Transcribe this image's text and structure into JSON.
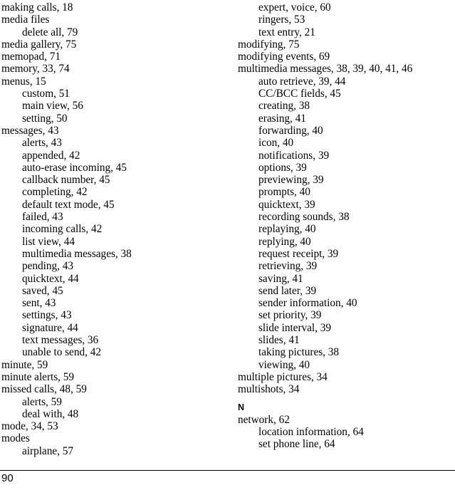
{
  "document": {
    "type": "book-index",
    "page_number": "90"
  },
  "columns": [
    {
      "name": "left-column",
      "entries": [
        {
          "text": "making calls, 18",
          "level": 0
        },
        {
          "text": "media files",
          "level": 0
        },
        {
          "text": "delete all, 79",
          "level": 1
        },
        {
          "text": "media gallery, 75",
          "level": 0
        },
        {
          "text": "memopad, 71",
          "level": 0
        },
        {
          "text": "memory, 33, 74",
          "level": 0
        },
        {
          "text": "menus, 15",
          "level": 0
        },
        {
          "text": "custom, 51",
          "level": 1
        },
        {
          "text": "main view, 56",
          "level": 1
        },
        {
          "text": "setting, 50",
          "level": 1
        },
        {
          "text": "messages, 43",
          "level": 0
        },
        {
          "text": "alerts, 43",
          "level": 1
        },
        {
          "text": "appended, 42",
          "level": 1
        },
        {
          "text": "auto-erase incoming, 45",
          "level": 1
        },
        {
          "text": "callback number, 45",
          "level": 1
        },
        {
          "text": "completing, 42",
          "level": 1
        },
        {
          "text": "default text mode, 45",
          "level": 1
        },
        {
          "text": "failed, 43",
          "level": 1
        },
        {
          "text": "incoming calls, 42",
          "level": 1
        },
        {
          "text": "list view, 44",
          "level": 1
        },
        {
          "text": "multimedia messages, 38",
          "level": 1
        },
        {
          "text": "pending, 43",
          "level": 1
        },
        {
          "text": "quicktext, 44",
          "level": 1
        },
        {
          "text": "saved, 45",
          "level": 1
        },
        {
          "text": "sent, 43",
          "level": 1
        },
        {
          "text": "settings, 43",
          "level": 1
        },
        {
          "text": "signature, 44",
          "level": 1
        },
        {
          "text": "text messages, 36",
          "level": 1
        },
        {
          "text": "unable to send, 42",
          "level": 1
        },
        {
          "text": "minute, 59",
          "level": 0
        },
        {
          "text": "minute alerts, 59",
          "level": 0
        },
        {
          "text": "missed calls, 48, 59",
          "level": 0
        },
        {
          "text": "alerts, 59",
          "level": 1
        },
        {
          "text": "deal with, 48",
          "level": 1
        },
        {
          "text": "mode, 34, 53",
          "level": 0
        },
        {
          "text": "modes",
          "level": 0
        },
        {
          "text": "airplane, 57",
          "level": 1
        }
      ]
    },
    {
      "name": "right-column",
      "entries": [
        {
          "text": "expert, voice, 60",
          "level": 1
        },
        {
          "text": "ringers, 53",
          "level": 1
        },
        {
          "text": "text entry, 21",
          "level": 1
        },
        {
          "text": "modifying, 75",
          "level": 0
        },
        {
          "text": "modifying events, 69",
          "level": 0
        },
        {
          "text": "multimedia messages, 38, 39, 40, 41, 46",
          "level": 0
        },
        {
          "text": "auto retrieve, 39, 44",
          "level": 1
        },
        {
          "text": "CC/BCC fields, 45",
          "level": 1
        },
        {
          "text": "creating, 38",
          "level": 1
        },
        {
          "text": "erasing, 41",
          "level": 1
        },
        {
          "text": "forwarding, 40",
          "level": 1
        },
        {
          "text": "icon, 40",
          "level": 1
        },
        {
          "text": "notifications, 39",
          "level": 1
        },
        {
          "text": "options, 39",
          "level": 1
        },
        {
          "text": "previewing, 39",
          "level": 1
        },
        {
          "text": "prompts, 40",
          "level": 1
        },
        {
          "text": "quicktext, 39",
          "level": 1
        },
        {
          "text": "recording sounds, 38",
          "level": 1
        },
        {
          "text": "replaying, 40",
          "level": 1
        },
        {
          "text": "replying, 40",
          "level": 1
        },
        {
          "text": "request receipt, 39",
          "level": 1
        },
        {
          "text": "retrieving, 39",
          "level": 1
        },
        {
          "text": "saving, 41",
          "level": 1
        },
        {
          "text": "send later, 39",
          "level": 1
        },
        {
          "text": "sender information, 40",
          "level": 1
        },
        {
          "text": "set priority, 39",
          "level": 1
        },
        {
          "text": "slide interval, 39",
          "level": 1
        },
        {
          "text": "slides, 41",
          "level": 1
        },
        {
          "text": "taking pictures, 38",
          "level": 1
        },
        {
          "text": "viewing, 40",
          "level": 1
        },
        {
          "text": "multiple pictures, 34",
          "level": 0
        },
        {
          "text": "multishots, 34",
          "level": 0
        },
        {
          "text": "N",
          "level": 0,
          "section_heading": true
        },
        {
          "text": "network, 62",
          "level": 0
        },
        {
          "text": "location information, 64",
          "level": 1
        },
        {
          "text": "set phone line, 64",
          "level": 1
        }
      ]
    }
  ]
}
